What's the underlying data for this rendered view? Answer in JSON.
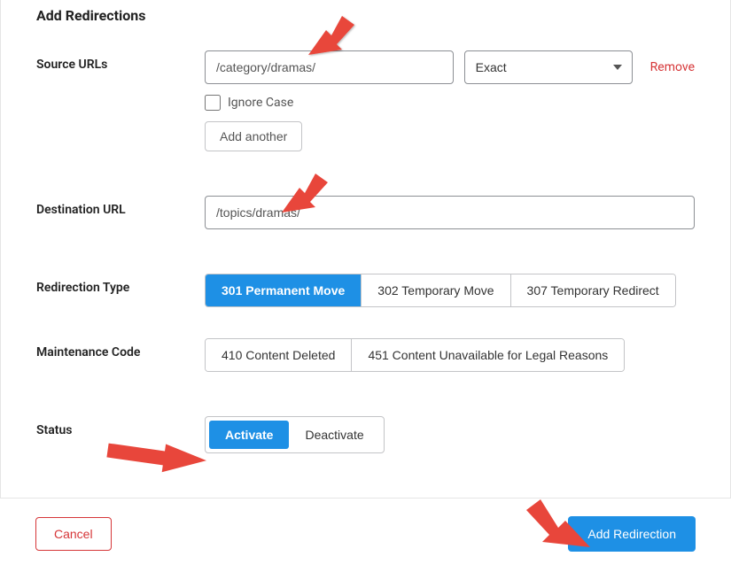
{
  "title": "Add Redirections",
  "labels": {
    "source_urls": "Source URLs",
    "destination_url": "Destination URL",
    "redirection_type": "Redirection Type",
    "maintenance_code": "Maintenance Code",
    "status": "Status"
  },
  "source": {
    "value": "/category/dramas/",
    "match_options": [
      "Exact"
    ],
    "match_selected": "Exact",
    "remove_label": "Remove",
    "ignore_case_label": "Ignore Case",
    "ignore_case_checked": false,
    "add_another_label": "Add another"
  },
  "destination": {
    "value": "/topics/dramas/"
  },
  "redirection_type": {
    "options": [
      {
        "label": "301 Permanent Move",
        "active": true
      },
      {
        "label": "302 Temporary Move",
        "active": false
      },
      {
        "label": "307 Temporary Redirect",
        "active": false
      }
    ]
  },
  "maintenance_code": {
    "options": [
      {
        "label": "410 Content Deleted",
        "active": false
      },
      {
        "label": "451 Content Unavailable for Legal Reasons",
        "active": false
      }
    ]
  },
  "status": {
    "options": [
      {
        "label": "Activate",
        "active": true
      },
      {
        "label": "Deactivate",
        "active": false
      }
    ]
  },
  "footer": {
    "cancel": "Cancel",
    "submit": "Add Redirection"
  },
  "colors": {
    "primary": "#1e90e5",
    "danger": "#d63638"
  }
}
